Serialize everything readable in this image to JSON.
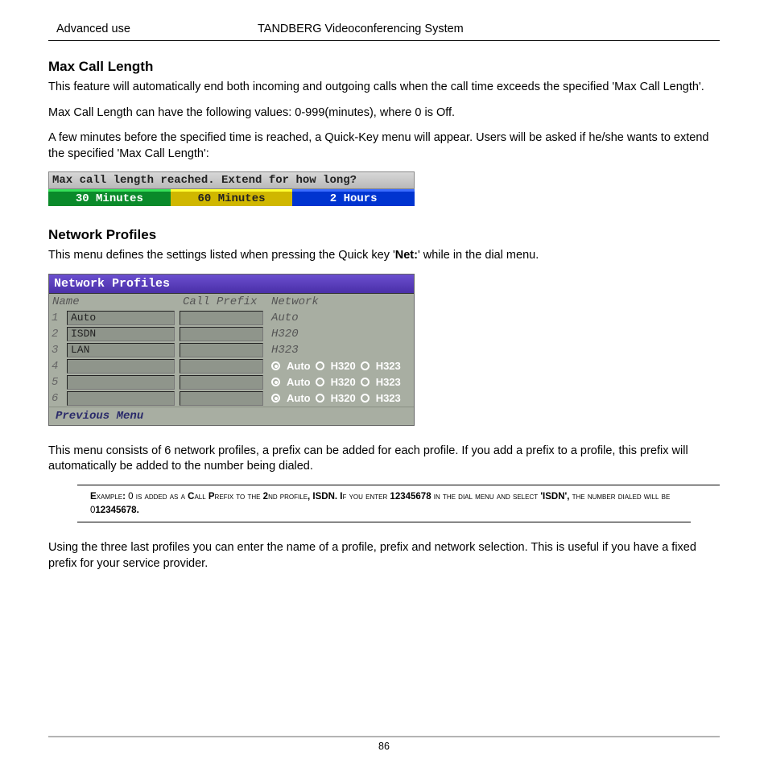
{
  "header": {
    "left": "Advanced use",
    "center": "TANDBERG Videoconferencing System"
  },
  "max_call": {
    "title": "Max Call Length",
    "p1": "This feature will automatically end both incoming and outgoing calls when the call time exceeds the  specified 'Max Call Length'.",
    "p2": "Max Call Length can have the following values: 0-999(minutes), where 0 is Off.",
    "p3": "A few minutes before the specified time is reached, a Quick-Key menu will appear. Users will be asked if he/she wants to extend the specified 'Max Call Length':",
    "qk_title": "Max call length reached. Extend for how long?",
    "qk_opts": [
      "30 Minutes",
      "60 Minutes",
      "2 Hours"
    ]
  },
  "net_profiles": {
    "title": "Network Profiles",
    "intro_pre": "This menu defines the settings listed when pressing the Quick key '",
    "intro_key": "Net:",
    "intro_post": "' while in the dial menu.",
    "box_title": "Network Profiles",
    "cols": [
      "Name",
      "Call Prefix",
      "Network"
    ],
    "rows": [
      {
        "n": "1",
        "name": "Auto",
        "net": "Auto",
        "radios": false
      },
      {
        "n": "2",
        "name": "ISDN",
        "net": "H320",
        "radios": false
      },
      {
        "n": "3",
        "name": "LAN",
        "net": "H323",
        "radios": false
      },
      {
        "n": "4",
        "name": "",
        "net": "",
        "radios": true
      },
      {
        "n": "5",
        "name": "",
        "net": "",
        "radios": true
      },
      {
        "n": "6",
        "name": "",
        "net": "",
        "radios": true
      }
    ],
    "radio_labels": [
      "Auto",
      "H320",
      "H323"
    ],
    "prev": "Previous Menu",
    "after": "This menu consists of 6 network profiles, a prefix can be added for each profile. If you add a prefix to a profile, this prefix  will automatically be added to the number being dialed.",
    "example": "Example: 0 is added as a Call Prefix to the 2nd profile, ISDN. If you enter 12345678 in the dial menu and select 'ISDN', the number dialed will be 012345678.",
    "after2": "Using the three last profiles you can enter the name of a profile, prefix and network selection. This is useful if you have a fixed prefix for your service provider."
  },
  "footer": {
    "page": "86"
  }
}
